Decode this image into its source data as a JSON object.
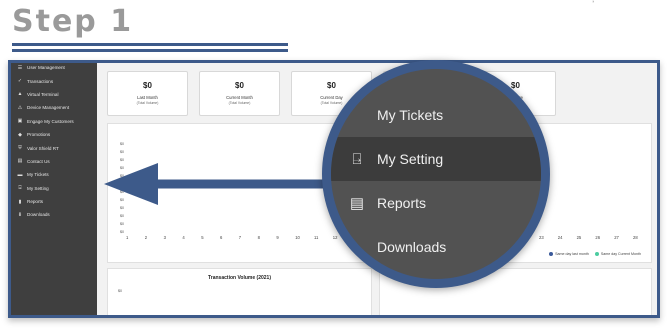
{
  "header": {
    "title": "Step 1",
    "corner_mark": "ʼ"
  },
  "sidebar": {
    "items": [
      {
        "label": "User Management",
        "icon": "users-icon",
        "glyph": "☰"
      },
      {
        "label": "Transactions",
        "icon": "check-icon",
        "glyph": "✓"
      },
      {
        "label": "Virtual Terminal",
        "icon": "terminal-icon",
        "glyph": "▲"
      },
      {
        "label": "Device Management",
        "icon": "device-icon",
        "glyph": "⚠"
      },
      {
        "label": "Engage My Customers",
        "icon": "engage-icon",
        "glyph": "▣"
      },
      {
        "label": "Promotions",
        "icon": "tag-icon",
        "glyph": "◆"
      },
      {
        "label": "Valor Shield RT",
        "icon": "shield-icon",
        "glyph": "⛨"
      },
      {
        "label": "Contact Us",
        "icon": "contact-icon",
        "glyph": "▤"
      },
      {
        "label": "My Tickets",
        "icon": "ticket-icon",
        "glyph": "▬"
      },
      {
        "label": "My Setting",
        "icon": "settings-icon",
        "glyph": "⍈"
      },
      {
        "label": "Reports",
        "icon": "reports-icon",
        "glyph": "▮"
      },
      {
        "label": "Downloads",
        "icon": "download-icon",
        "glyph": "⬇"
      }
    ]
  },
  "cards": [
    {
      "value": "$0",
      "label": "Last Month",
      "sub": "(Total Volume)"
    },
    {
      "value": "$0",
      "label": "Current Month",
      "sub": "(Total Volume)"
    },
    {
      "value": "$0",
      "label": "Current Day",
      "sub": "(Total Volume)"
    },
    {
      "value": "$0",
      "label": "",
      "sub": ""
    },
    {
      "value": "$0",
      "label": "ket Size",
      "sub": "ne)"
    }
  ],
  "chart": {
    "y_ticks": [
      "$0",
      "$0",
      "$0",
      "$0",
      "$0",
      "$0",
      "$0",
      "$0",
      "$0",
      "$0",
      "$0",
      "$0"
    ],
    "x_ticks_left": [
      "1",
      "2",
      "3",
      "4",
      "5",
      "6",
      "7",
      "8",
      "9",
      "10",
      "11",
      "12"
    ],
    "x_ticks_right": [
      "23",
      "24",
      "25",
      "26",
      "27",
      "28"
    ],
    "legend": [
      {
        "label": "Same day last month",
        "color": "#3b5a9a"
      },
      {
        "label": "Same day Current Month",
        "color": "#4ccca0"
      }
    ]
  },
  "bottom": {
    "title": "Transaction Volume (2021)",
    "y0": "$0"
  },
  "zoom": {
    "items": [
      {
        "label": "My Tickets",
        "icon": "ticket-icon",
        "glyph": ""
      },
      {
        "label": "My Setting",
        "icon": "settings-icon",
        "glyph": "⍈"
      },
      {
        "label": "Reports",
        "icon": "reports-icon",
        "glyph": "▤"
      },
      {
        "label": "Downloads",
        "icon": "download-icon",
        "glyph": ""
      }
    ]
  },
  "colors": {
    "accent": "#3d5a8a",
    "sidebar": "#3f3f3f"
  }
}
